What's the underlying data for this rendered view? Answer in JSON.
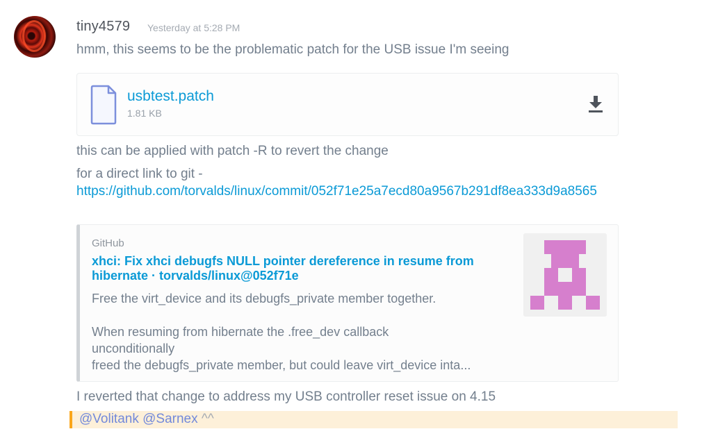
{
  "message": {
    "username": "tiny4579",
    "timestamp": "Yesterday at 5:28 PM",
    "lines": [
      "hmm, this seems to be the problematic patch for the USB issue I'm seeing",
      "this can be applied with patch -R to revert the change",
      "for a direct link to git -",
      "I reverted that change to address my USB controller reset issue on 4.15"
    ],
    "link": "https://github.com/torvalds/linux/commit/052f71e25a7ecd80a9567b291df8ea333d9a8565",
    "mentions": [
      "@Volitank",
      "@Sarnex"
    ],
    "mention_suffix": " ^^"
  },
  "attachment": {
    "filename": "usbtest.patch",
    "size": "1.81 KB",
    "icon": "file-icon",
    "action_icon": "download-icon"
  },
  "embed": {
    "provider": "GitHub",
    "title": "xhci: Fix xhci debugfs NULL pointer dereference in resume from hibernate · torvalds/linux@052f71e",
    "description": "Free the virt_device and its debugfs_private member together.\n\nWhen resuming from hibernate the .free_dev callback\nunconditionally\nfreed the debugfs_private member, but could leave virt_device inta...",
    "thumbnail_color": "#d67fcd"
  },
  "colors": {
    "link": "#0b9ad6",
    "mention": "#7289da",
    "mention_highlight_bg": "#fdf0d9",
    "mention_highlight_bar": "#faa61a"
  }
}
